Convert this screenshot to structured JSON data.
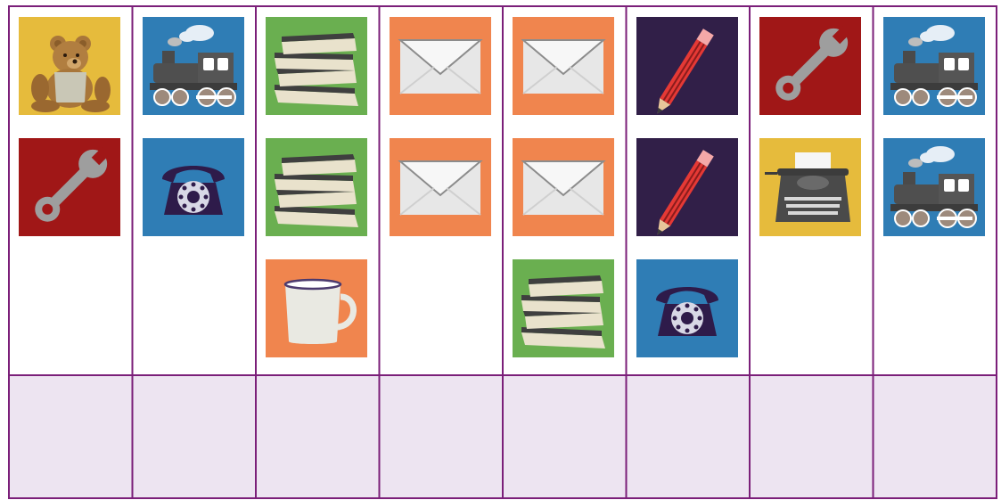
{
  "board": {
    "colors": {
      "border": "#7b1f79",
      "foundation_fill": "#ede4f1",
      "tableau_fill": "#ffffff"
    },
    "columns": [
      {
        "tiles": [
          "teddy-bear",
          "wrench"
        ]
      },
      {
        "tiles": [
          "train",
          "telephone"
        ]
      },
      {
        "tiles": [
          "books",
          "books",
          "mug"
        ]
      },
      {
        "tiles": [
          "envelope",
          "envelope"
        ]
      },
      {
        "tiles": [
          "envelope",
          "envelope",
          "books"
        ]
      },
      {
        "tiles": [
          "pencil",
          "pencil",
          "telephone"
        ]
      },
      {
        "tiles": [
          "wrench",
          "typewriter"
        ]
      },
      {
        "tiles": [
          "train",
          "train"
        ]
      }
    ],
    "foundation_slots": 8
  },
  "tile_types": {
    "teddy-bear": {
      "icon": "teddy-bear-icon",
      "background": "#e6bb3c"
    },
    "train": {
      "icon": "train-icon",
      "background": "#2f7db5"
    },
    "books": {
      "icon": "books-icon",
      "background": "#6aaf50"
    },
    "envelope": {
      "icon": "envelope-icon",
      "background": "#f0854e"
    },
    "pencil": {
      "icon": "pencil-icon",
      "background": "#311f48"
    },
    "wrench": {
      "icon": "wrench-icon",
      "background": "#a01717"
    },
    "telephone": {
      "icon": "telephone-icon",
      "background": "#2f7db5"
    },
    "mug": {
      "icon": "mug-icon",
      "background": "#f0854e"
    },
    "typewriter": {
      "icon": "typewriter-icon",
      "background": "#e6bb3c"
    }
  }
}
